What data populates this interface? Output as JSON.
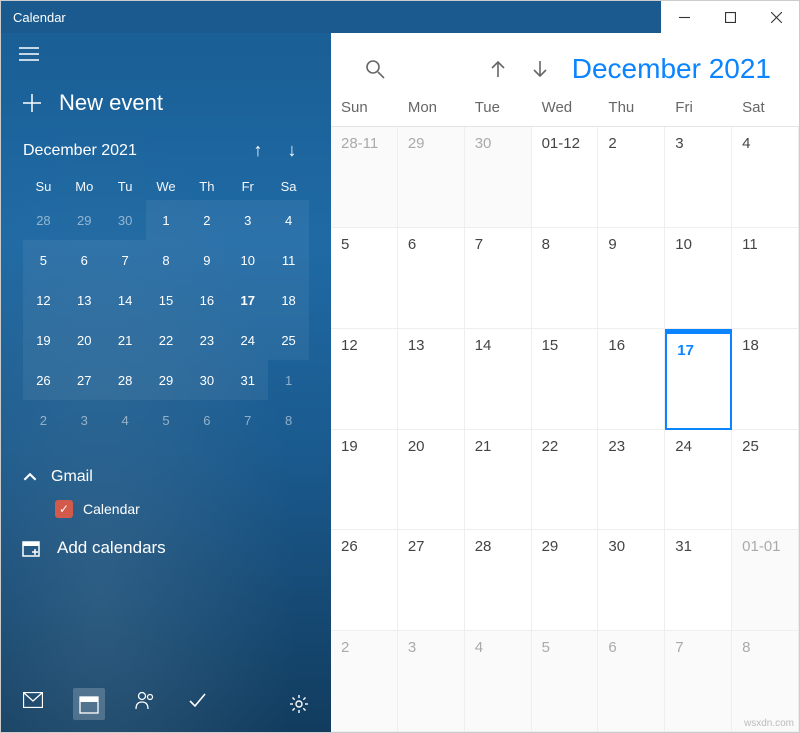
{
  "window": {
    "title": "Calendar"
  },
  "sidebar": {
    "new_event_label": "New event",
    "mini": {
      "title": "December 2021",
      "dow": [
        "Su",
        "Mo",
        "Tu",
        "We",
        "Th",
        "Fr",
        "Sa"
      ],
      "cells": [
        {
          "n": "28",
          "dim": true
        },
        {
          "n": "29",
          "dim": true
        },
        {
          "n": "30",
          "dim": true
        },
        {
          "n": "1",
          "in": true
        },
        {
          "n": "2",
          "in": true
        },
        {
          "n": "3",
          "in": true
        },
        {
          "n": "4",
          "in": true
        },
        {
          "n": "5",
          "in": true
        },
        {
          "n": "6",
          "in": true
        },
        {
          "n": "7",
          "in": true
        },
        {
          "n": "8",
          "in": true
        },
        {
          "n": "9",
          "in": true
        },
        {
          "n": "10",
          "in": true
        },
        {
          "n": "11",
          "in": true
        },
        {
          "n": "12",
          "in": true
        },
        {
          "n": "13",
          "in": true
        },
        {
          "n": "14",
          "in": true
        },
        {
          "n": "15",
          "in": true
        },
        {
          "n": "16",
          "in": true
        },
        {
          "n": "17",
          "in": true,
          "today": true
        },
        {
          "n": "18",
          "in": true
        },
        {
          "n": "19",
          "in": true
        },
        {
          "n": "20",
          "in": true
        },
        {
          "n": "21",
          "in": true
        },
        {
          "n": "22",
          "in": true
        },
        {
          "n": "23",
          "in": true
        },
        {
          "n": "24",
          "in": true
        },
        {
          "n": "25",
          "in": true
        },
        {
          "n": "26",
          "in": true
        },
        {
          "n": "27",
          "in": true
        },
        {
          "n": "28",
          "in": true
        },
        {
          "n": "29",
          "in": true
        },
        {
          "n": "30",
          "in": true
        },
        {
          "n": "31",
          "in": true
        },
        {
          "n": "1",
          "dim": true
        },
        {
          "n": "2",
          "dim": true
        },
        {
          "n": "3",
          "dim": true
        },
        {
          "n": "4",
          "dim": true
        },
        {
          "n": "5",
          "dim": true
        },
        {
          "n": "6",
          "dim": true
        },
        {
          "n": "7",
          "dim": true
        },
        {
          "n": "8",
          "dim": true
        }
      ]
    },
    "account": {
      "name": "Gmail",
      "calendar_label": "Calendar"
    },
    "add_calendars_label": "Add calendars"
  },
  "main": {
    "title": "December 2021",
    "dow": [
      "Sun",
      "Mon",
      "Tue",
      "Wed",
      "Thu",
      "Fri",
      "Sat"
    ],
    "cells": [
      {
        "n": "28-11",
        "other": true
      },
      {
        "n": "29",
        "other": true
      },
      {
        "n": "30",
        "other": true
      },
      {
        "n": "01-12"
      },
      {
        "n": "2"
      },
      {
        "n": "3"
      },
      {
        "n": "4"
      },
      {
        "n": "5"
      },
      {
        "n": "6"
      },
      {
        "n": "7"
      },
      {
        "n": "8"
      },
      {
        "n": "9"
      },
      {
        "n": "10"
      },
      {
        "n": "11"
      },
      {
        "n": "12"
      },
      {
        "n": "13"
      },
      {
        "n": "14"
      },
      {
        "n": "15"
      },
      {
        "n": "16"
      },
      {
        "n": "17",
        "today": true
      },
      {
        "n": "18"
      },
      {
        "n": "19"
      },
      {
        "n": "20"
      },
      {
        "n": "21"
      },
      {
        "n": "22"
      },
      {
        "n": "23"
      },
      {
        "n": "24"
      },
      {
        "n": "25"
      },
      {
        "n": "26"
      },
      {
        "n": "27"
      },
      {
        "n": "28"
      },
      {
        "n": "29"
      },
      {
        "n": "30"
      },
      {
        "n": "31"
      },
      {
        "n": "01-01",
        "other": true
      },
      {
        "n": "2",
        "other": true
      },
      {
        "n": "3",
        "other": true
      },
      {
        "n": "4",
        "other": true
      },
      {
        "n": "5",
        "other": true
      },
      {
        "n": "6",
        "other": true
      },
      {
        "n": "7",
        "other": true
      },
      {
        "n": "8",
        "other": true
      }
    ]
  },
  "watermark": "wsxdn.com"
}
